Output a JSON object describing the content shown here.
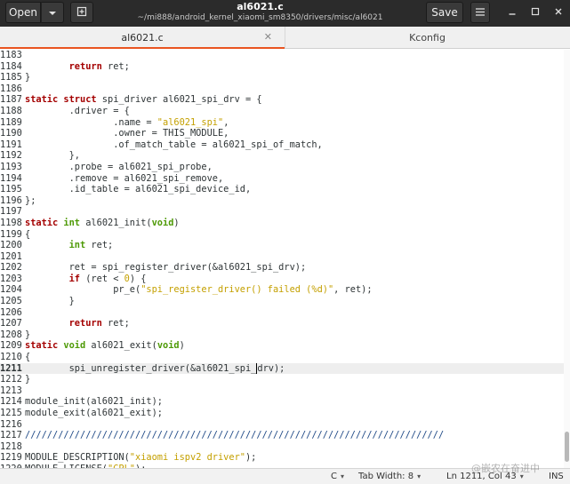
{
  "window": {
    "title": "al6021.c",
    "subtitle": "~/mi888/android_kernel_xiaomi_sm8350/drivers/misc/al6021"
  },
  "header": {
    "open_label": "Open",
    "save_label": "Save"
  },
  "tabs": [
    {
      "label": "al6021.c",
      "active": true
    },
    {
      "label": "Kconfig",
      "active": false
    }
  ],
  "editor": {
    "current_line": 1211,
    "lines": [
      {
        "n": "1183",
        "parts": []
      },
      {
        "n": "1184",
        "parts": [
          [
            "",
            "        "
          ],
          [
            "kw",
            "return"
          ],
          [
            "",
            " ret;"
          ]
        ]
      },
      {
        "n": "1185",
        "parts": [
          [
            "",
            "}"
          ]
        ]
      },
      {
        "n": "1186",
        "parts": []
      },
      {
        "n": "1187",
        "parts": [
          [
            "kw",
            "static"
          ],
          [
            "",
            " "
          ],
          [
            "kw",
            "struct"
          ],
          [
            "",
            " spi_driver al6021_spi_drv = {"
          ]
        ]
      },
      {
        "n": "1188",
        "parts": [
          [
            "",
            "        .driver = {"
          ]
        ]
      },
      {
        "n": "1189",
        "parts": [
          [
            "",
            "                .name = "
          ],
          [
            "st",
            "\"al6021_spi\""
          ],
          [
            "",
            ","
          ]
        ]
      },
      {
        "n": "1190",
        "parts": [
          [
            "",
            "                .owner = THIS_MODULE,"
          ]
        ]
      },
      {
        "n": "1191",
        "parts": [
          [
            "",
            "                .of_match_table = al6021_spi_of_match,"
          ]
        ]
      },
      {
        "n": "1192",
        "parts": [
          [
            "",
            "        },"
          ]
        ]
      },
      {
        "n": "1193",
        "parts": [
          [
            "",
            "        .probe = al6021_spi_probe,"
          ]
        ]
      },
      {
        "n": "1194",
        "parts": [
          [
            "",
            "        .remove = al6021_spi_remove,"
          ]
        ]
      },
      {
        "n": "1195",
        "parts": [
          [
            "",
            "        .id_table = al6021_spi_device_id,"
          ]
        ]
      },
      {
        "n": "1196",
        "parts": [
          [
            "",
            "};"
          ]
        ]
      },
      {
        "n": "1197",
        "parts": []
      },
      {
        "n": "1198",
        "parts": [
          [
            "kw",
            "static"
          ],
          [
            "",
            " "
          ],
          [
            "ty",
            "int"
          ],
          [
            "",
            " al6021_init("
          ],
          [
            "ty",
            "void"
          ],
          [
            "",
            ")"
          ]
        ]
      },
      {
        "n": "1199",
        "parts": [
          [
            "",
            "{"
          ]
        ]
      },
      {
        "n": "1200",
        "parts": [
          [
            "",
            "        "
          ],
          [
            "ty",
            "int"
          ],
          [
            "",
            " ret;"
          ]
        ]
      },
      {
        "n": "1201",
        "parts": []
      },
      {
        "n": "1202",
        "parts": [
          [
            "",
            "        ret = spi_register_driver(&al6021_spi_drv);"
          ]
        ]
      },
      {
        "n": "1203",
        "parts": [
          [
            "",
            "        "
          ],
          [
            "kw",
            "if"
          ],
          [
            "",
            " (ret < "
          ],
          [
            "nu",
            "0"
          ],
          [
            "",
            ") {"
          ]
        ]
      },
      {
        "n": "1204",
        "parts": [
          [
            "",
            "                pr_e("
          ],
          [
            "st",
            "\"spi_register_driver() failed (%d)\""
          ],
          [
            "",
            ", ret);"
          ]
        ]
      },
      {
        "n": "1205",
        "parts": [
          [
            "",
            "        }"
          ]
        ]
      },
      {
        "n": "1206",
        "parts": []
      },
      {
        "n": "1207",
        "parts": [
          [
            "",
            "        "
          ],
          [
            "kw",
            "return"
          ],
          [
            "",
            " ret;"
          ]
        ]
      },
      {
        "n": "1208",
        "parts": [
          [
            "",
            "}"
          ]
        ]
      },
      {
        "n": "1209",
        "parts": [
          [
            "kw",
            "static"
          ],
          [
            "",
            " "
          ],
          [
            "ty",
            "void"
          ],
          [
            "",
            " al6021_exit("
          ],
          [
            "ty",
            "void"
          ],
          [
            "",
            ")"
          ]
        ]
      },
      {
        "n": "1210",
        "parts": [
          [
            "",
            "{"
          ]
        ]
      },
      {
        "n": "1211",
        "parts": [
          [
            "",
            "        spi_unregister_driver(&al6021_spi_"
          ],
          [
            "cursor",
            "d"
          ],
          [
            "",
            "rv);"
          ]
        ]
      },
      {
        "n": "1212",
        "parts": [
          [
            "",
            "}"
          ]
        ]
      },
      {
        "n": "1213",
        "parts": []
      },
      {
        "n": "1214",
        "parts": [
          [
            "",
            "module_init(al6021_init);"
          ]
        ]
      },
      {
        "n": "1215",
        "parts": [
          [
            "",
            "module_exit(al6021_exit);"
          ]
        ]
      },
      {
        "n": "1216",
        "parts": []
      },
      {
        "n": "1217",
        "parts": [
          [
            "cm",
            "////////////////////////////////////////////////////////////////////////////"
          ]
        ]
      },
      {
        "n": "1218",
        "parts": []
      },
      {
        "n": "1219",
        "parts": [
          [
            "",
            "MODULE_DESCRIPTION("
          ],
          [
            "st",
            "\"xiaomi ispv2 driver\""
          ],
          [
            "",
            ");"
          ]
        ]
      },
      {
        "n": "1220",
        "parts": [
          [
            "",
            "MODULE_LICENSE("
          ],
          [
            "st",
            "\"GPL\""
          ],
          [
            "",
            ");"
          ]
        ]
      }
    ]
  },
  "statusbar": {
    "language": "C",
    "tab_width": "Tab Width: 8",
    "position": "Ln 1211, Col 43",
    "mode": "INS"
  },
  "watermark": "@嵌农在奋进中"
}
